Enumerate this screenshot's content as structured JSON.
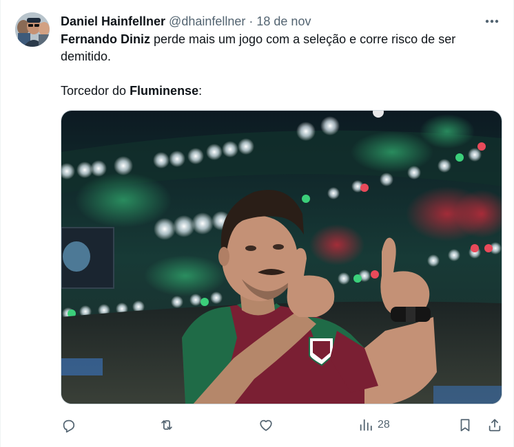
{
  "tweet": {
    "author_name": "Daniel Hainfellner",
    "author_handle": "@dhainfellner",
    "separator": "·",
    "timestamp": "18 de nov",
    "text": {
      "line1_bold": "Fernando Diniz",
      "line1_rest": " perde mais um jogo com a seleção e corre risco de ser demitido.",
      "line2_prefix": "Torcedor do ",
      "line2_bold": "Fluminense",
      "line2_suffix": ":"
    },
    "views_count": "28"
  },
  "icons": {
    "more": "more-horizontal-icon",
    "reply": "reply-icon",
    "retweet": "retweet-icon",
    "like": "heart-icon",
    "views": "analytics-icon",
    "bookmark": "bookmark-icon",
    "share": "share-icon"
  },
  "colors": {
    "text_primary": "#0f1419",
    "text_secondary": "#536471",
    "jersey_maroon": "#7a1f33",
    "jersey_green": "#1f6b47"
  }
}
